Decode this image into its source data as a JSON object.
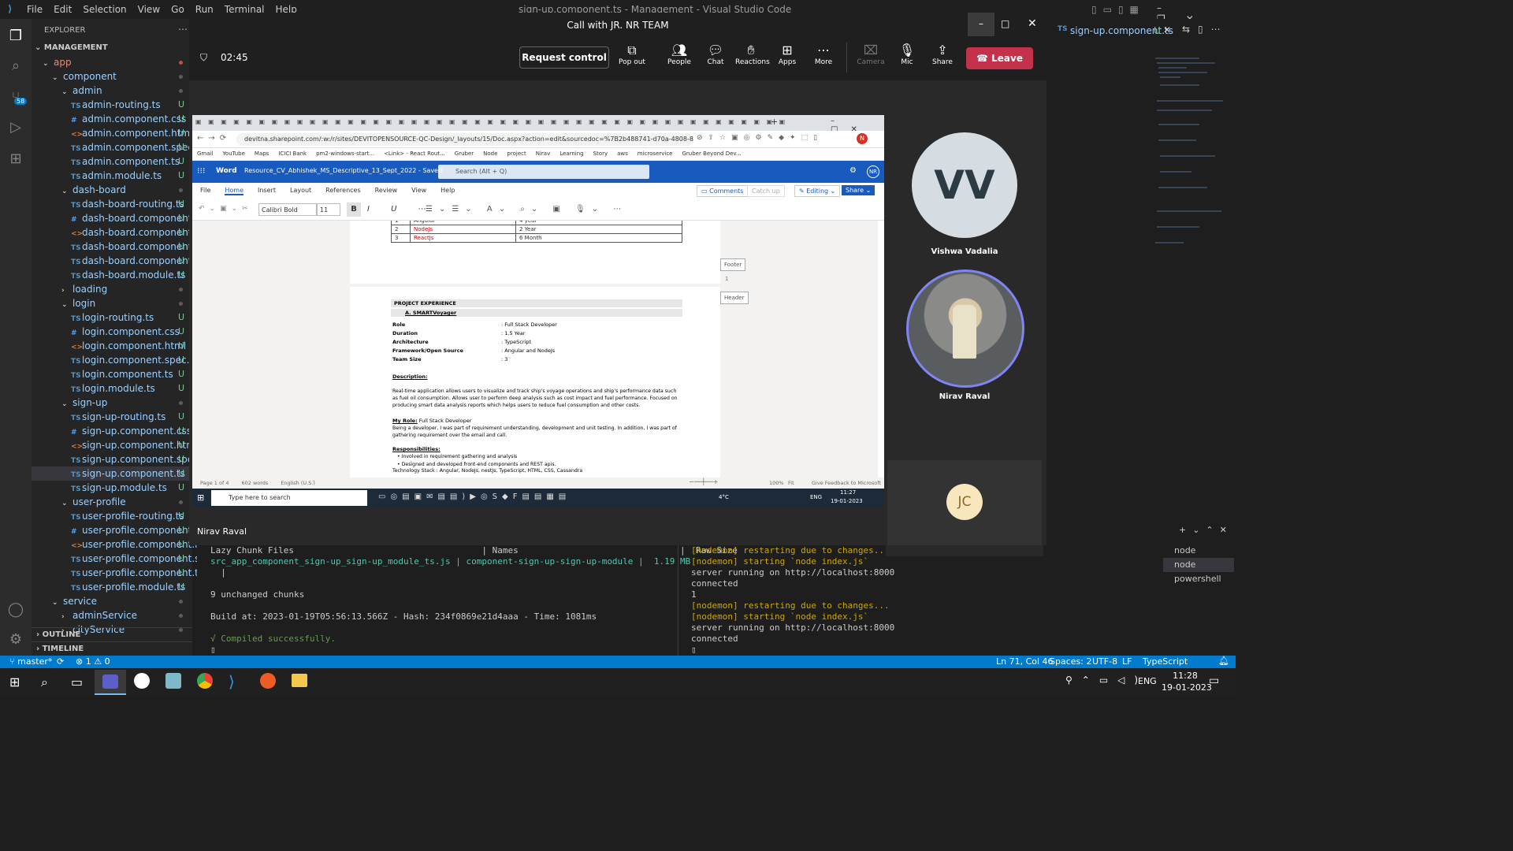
{
  "vscode": {
    "menu": [
      "File",
      "Edit",
      "Selection",
      "View",
      "Go",
      "Run",
      "Terminal",
      "Help"
    ],
    "title": "sign-up.component.ts - Management - Visual Studio Code",
    "explorer": "EXPLORER",
    "project": "MANAGEMENT",
    "tab": "sign-up.component.ts",
    "tab_badge": "U",
    "scm_badge": "58"
  },
  "tree": [
    {
      "t": "app",
      "lv": 1,
      "k": "folder",
      "open": true,
      "dot": "red"
    },
    {
      "t": "component",
      "lv": 2,
      "k": "folder",
      "open": true
    },
    {
      "t": "admin",
      "lv": 3,
      "k": "folder",
      "open": true
    },
    {
      "t": "admin-routing.ts",
      "lv": 4,
      "k": "ts",
      "b": "U"
    },
    {
      "t": "admin.component.css",
      "lv": 4,
      "k": "css",
      "b": "U"
    },
    {
      "t": "admin.component.html",
      "lv": 4,
      "k": "html",
      "b": "U"
    },
    {
      "t": "admin.component.spec.ts",
      "lv": 4,
      "k": "ts",
      "b": "U"
    },
    {
      "t": "admin.component.ts",
      "lv": 4,
      "k": "ts",
      "b": "U"
    },
    {
      "t": "admin.module.ts",
      "lv": 4,
      "k": "ts",
      "b": "U"
    },
    {
      "t": "dash-board",
      "lv": 3,
      "k": "folder",
      "open": true
    },
    {
      "t": "dash-board-routing.ts",
      "lv": 4,
      "k": "ts",
      "b": "U"
    },
    {
      "t": "dash-board.component.css",
      "lv": 4,
      "k": "css",
      "b": "U"
    },
    {
      "t": "dash-board.component.h...",
      "lv": 4,
      "k": "html",
      "b": "U"
    },
    {
      "t": "dash-board.component.s...",
      "lv": 4,
      "k": "ts",
      "b": "U"
    },
    {
      "t": "dash-board.component.ts",
      "lv": 4,
      "k": "ts",
      "b": "U"
    },
    {
      "t": "dash-board.module.ts",
      "lv": 4,
      "k": "ts",
      "b": "U"
    },
    {
      "t": "loading",
      "lv": 3,
      "k": "folder",
      "open": false
    },
    {
      "t": "login",
      "lv": 3,
      "k": "folder",
      "open": true
    },
    {
      "t": "login-routing.ts",
      "lv": 4,
      "k": "ts",
      "b": "U"
    },
    {
      "t": "login.component.css",
      "lv": 4,
      "k": "css",
      "b": "U"
    },
    {
      "t": "login.component.html",
      "lv": 4,
      "k": "html",
      "b": "U"
    },
    {
      "t": "login.component.spec.ts",
      "lv": 4,
      "k": "ts",
      "b": "U"
    },
    {
      "t": "login.component.ts",
      "lv": 4,
      "k": "ts",
      "b": "U"
    },
    {
      "t": "login.module.ts",
      "lv": 4,
      "k": "ts",
      "b": "U"
    },
    {
      "t": "sign-up",
      "lv": 3,
      "k": "folder",
      "open": true
    },
    {
      "t": "sign-up-routing.ts",
      "lv": 4,
      "k": "ts",
      "b": "U"
    },
    {
      "t": "sign-up.component.css",
      "lv": 4,
      "k": "css",
      "b": "U"
    },
    {
      "t": "sign-up.component.html",
      "lv": 4,
      "k": "html",
      "b": "U"
    },
    {
      "t": "sign-up.component.spec.ts",
      "lv": 4,
      "k": "ts",
      "b": "U"
    },
    {
      "t": "sign-up.component.ts",
      "lv": 4,
      "k": "ts",
      "b": "U",
      "sel": true
    },
    {
      "t": "sign-up.module.ts",
      "lv": 4,
      "k": "ts",
      "b": "U"
    },
    {
      "t": "user-profile",
      "lv": 3,
      "k": "folder",
      "open": true
    },
    {
      "t": "user-profile-routing.ts",
      "lv": 4,
      "k": "ts",
      "b": "U"
    },
    {
      "t": "user-profile.component.css",
      "lv": 4,
      "k": "css",
      "b": "U"
    },
    {
      "t": "user-profile.component.h...",
      "lv": 4,
      "k": "html",
      "b": "U"
    },
    {
      "t": "user-profile.component.s...",
      "lv": 4,
      "k": "ts",
      "b": "U"
    },
    {
      "t": "user-profile.component.ts",
      "lv": 4,
      "k": "ts",
      "b": "U"
    },
    {
      "t": "user-profile.module.ts",
      "lv": 4,
      "k": "ts",
      "b": "U"
    },
    {
      "t": "service",
      "lv": 2,
      "k": "folder",
      "open": true
    },
    {
      "t": "adminService",
      "lv": 3,
      "k": "folder",
      "open": false
    },
    {
      "t": "cityService",
      "lv": 3,
      "k": "folder",
      "open": false
    }
  ],
  "sections": {
    "outline": "OUTLINE",
    "timeline": "TIMELINE"
  },
  "terminal": {
    "left": [
      "Lazy Chunk Files                                    | Names                               |  Raw Size",
      "src_app_component_sign-up_sign-up_module_ts.js | component-sign-up-sign-up-module |  1.19 MB",
      "  |",
      "",
      "9 unchanged chunks",
      "",
      "Build at: 2023-01-19T05:56:13.566Z - Hash: 234f0869e21d4aaa - Time: 1081ms",
      "",
      "√ Compiled successfully.",
      "▯"
    ],
    "right": [
      "[nodemon] restarting due to changes...",
      "[nodemon] starting `node index.js`",
      "server running on http://localhost:8000",
      "connected",
      "1",
      "[nodemon] restarting due to changes...",
      "[nodemon] starting `node index.js`",
      "server running on http://localhost:8000",
      "connected",
      "▯"
    ],
    "shells": [
      "node",
      "node",
      "powershell"
    ]
  },
  "status": {
    "branch": "master*",
    "errors": "⊗ 1 ⚠ 0",
    "pos": "Ln 71, Col 46",
    "spaces": "Spaces: 2",
    "enc": "UTF-8",
    "eol": "LF",
    "lang": "TypeScript"
  },
  "taskbar": {
    "time": "11:28",
    "date": "19-01-2023",
    "lang": "ENG"
  },
  "teams": {
    "title": "Call with JR. NR TEAM",
    "timer": "02:45",
    "request": "Request control",
    "popout": "Pop out",
    "people": "People",
    "chat": "Chat",
    "reactions": "Reactions",
    "apps": "Apps",
    "more": "More",
    "camera": "Camera",
    "mic": "Mic",
    "share": "Share",
    "leave": "Leave",
    "sharer": "Nirav Raval",
    "participants": [
      {
        "initials": "VV",
        "name": "Vishwa Vadalia"
      },
      {
        "initials": "",
        "name": "Nirav Raval"
      },
      {
        "initials": "JC",
        "name": ""
      }
    ]
  },
  "browser": {
    "url": "devitna.sharepoint.com/:w:/r/sites/DEVITOPENSOURCE-QC-Design/_layouts/15/Doc.aspx?action=edit&sourcedoc=%7B2b488741-d70a-4808-81f4-ce1dfa...",
    "bookmarks": [
      "Gmail",
      "YouTube",
      "Maps",
      "ICICI Bank",
      "pm2-windows-start...",
      "<Link> - React Rout...",
      "Gruber",
      "Node",
      "project",
      "Nirav",
      "Learning",
      "Story",
      "aws",
      "microservice",
      "Gruber Beyond Dev..."
    ]
  },
  "word": {
    "app": "Word",
    "doc": "Resource_CV_Abhishek_MS_Descriptive_13_Sept_2022  -  Saved",
    "search": "Search (Alt + Q)",
    "menus": [
      "File",
      "Home",
      "Insert",
      "Layout",
      "References",
      "Review",
      "View",
      "Help"
    ],
    "comments": "Comments",
    "catchup": "Catch up",
    "editing": "Editing",
    "share": "Share",
    "font": "Calibri Bold",
    "size": "11",
    "footer": "Footer",
    "header": "Header",
    "pagenum": "1",
    "table": [
      [
        "1",
        "Angular",
        "4 year"
      ],
      [
        "2",
        "NodeJs",
        "2 Year"
      ],
      [
        "3",
        "ReactJs",
        "6 Month"
      ]
    ],
    "section": "PROJECT EXPERIENCE",
    "project": "A.    SMARTVoyager",
    "fields": [
      [
        "Role",
        ": Full Stack Developer"
      ],
      [
        "Duration",
        ": 1.5 Year"
      ],
      [
        "Architecture",
        ": TypeScript"
      ],
      [
        "Framework/Open Source",
        ": Angular and NodeJs"
      ],
      [
        "Team Size",
        ": 3"
      ]
    ],
    "desc_h": "Description:",
    "desc": "Real-time application allows users to visualize and track ship's voyage operations and ship's performance data such as fuel oil consumption. Allows user to perform deep analysis such as cost impact and fuel performance. Focused on producing smart data analysis reports which helps users to reduce fuel consumption and other costs.",
    "role_h": "My Role:",
    "role": " Full Stack Developer",
    "role_p": "Being a developer, I was part of requirement understanding, development and unit testing. In addition, I was part of gathering requirement over the email and call.",
    "resp_h": "Responsibilities:",
    "resp": [
      "Involved in requirement gathering and analysis",
      "Designed and developed front-end components and REST apis."
    ],
    "tech": "Technology Stack : Angular, NodeJs, nestJs, TypeScript, HTML, CSS, Cassandra",
    "status": [
      "Page 1 of 4",
      "602 words",
      "English (U.S.)"
    ],
    "zoom": "100%",
    "fit": "Fit",
    "feedback": "Give Feedback to Microsoft"
  },
  "inner_taskbar": {
    "search": "Type here to search",
    "temp": "4°C",
    "lang": "ENG",
    "time": "11:27",
    "date": "19-01-2023"
  }
}
